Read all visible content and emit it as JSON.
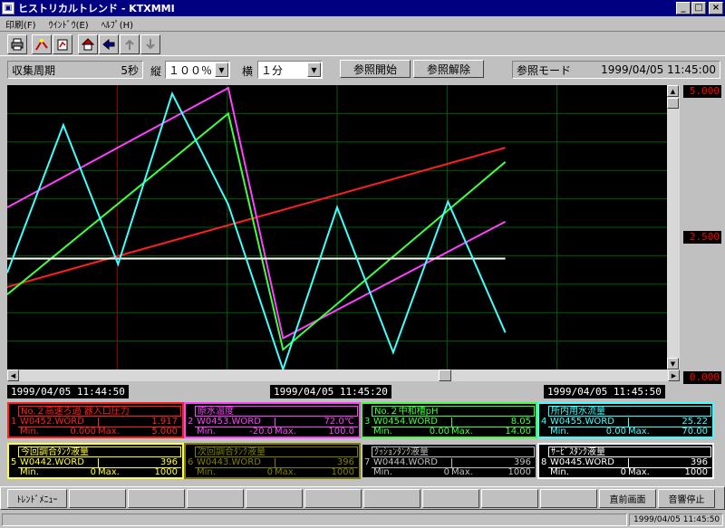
{
  "window": {
    "title": "ヒストリカルトレンド - KTXMMI",
    "minimize": "_",
    "maximize": "□",
    "close": "×"
  },
  "menu": [
    "印刷(F)",
    "ｳｲﾝﾄﾞｳ(E)",
    "ﾍﾙﾌﾟ(H)"
  ],
  "toolbar_icons": [
    "print-icon",
    "trend-edit-icon",
    "trend-settings-icon",
    "home-icon",
    "back-icon",
    "prev-page-icon",
    "next-page-icon"
  ],
  "controls": {
    "collect_label": "収集周期",
    "collect_value": "5秒",
    "vert_label": "縦",
    "vert_value": "１００％",
    "horiz_label": "横",
    "horiz_value": "１分",
    "ref_start": "参照開始",
    "ref_cancel": "参照解除",
    "mode_label": "参照モード",
    "mode_time": "1999/04/05 11:45:00"
  },
  "chart_data": {
    "type": "line",
    "ylim": [
      0,
      5
    ],
    "ytick_labels": [
      "5.000",
      "2.500",
      "0.000"
    ],
    "time_labels": [
      "1999/04/05 11:44:50",
      "1999/04/05 11:45:20",
      "1999/04/05 11:45:50"
    ],
    "series": [
      {
        "color": "#ff2020",
        "x": [
          0,
          0.755
        ],
        "y": [
          1.45,
          3.9
        ]
      },
      {
        "color": "#ff40ff",
        "x": [
          0,
          0.335,
          0.418,
          0.755
        ],
        "y": [
          2.85,
          4.95,
          0.55,
          2.6
        ]
      },
      {
        "color": "#40ff40",
        "x": [
          0,
          0.335,
          0.418,
          0.755
        ],
        "y": [
          1.32,
          4.5,
          0.35,
          3.65
        ]
      },
      {
        "color": "#ffffff",
        "x": [
          0,
          0.755
        ],
        "y": [
          1.95,
          1.95
        ]
      },
      {
        "color": "#40ffff",
        "x": [
          0,
          0.085,
          0.168,
          0.25,
          0.335,
          0.418,
          0.5,
          0.585,
          0.668,
          0.755
        ],
        "y": [
          1.7,
          4.3,
          1.85,
          4.85,
          2.9,
          0,
          2.85,
          0.3,
          2.95,
          0.65
        ]
      }
    ]
  },
  "panels": [
    {
      "num": "1",
      "name": "No.２高速ろ過 器入口圧力",
      "tag": "W0452.WORD",
      "value": "1.917",
      "min_label": "Min.",
      "min": "0.000",
      "max_label": "Max.",
      "max": "5.000",
      "color": "#ff2020"
    },
    {
      "num": "2",
      "name": "原水温度",
      "tag": "W0453.WORD",
      "value": "72.0℃",
      "min_label": "Min.",
      "min": "-20.0",
      "max_label": "Max.",
      "max": "100.0",
      "color": "#ff40ff"
    },
    {
      "num": "3",
      "name": "No.２中和槽pH",
      "tag": "W0454.WORD",
      "value": "8.05",
      "min_label": "Min.",
      "min": "0.00",
      "max_label": "Max.",
      "max": "14.00",
      "color": "#40ff40"
    },
    {
      "num": "4",
      "name": "所内用水流量",
      "tag": "W0455.WORD",
      "value": "25.22",
      "min_label": "Min.",
      "min": "0.00",
      "max_label": "Max.",
      "max": "70.00",
      "color": "#40ffff"
    },
    {
      "num": "5",
      "name": "今回調合ﾀﾝｸ液量",
      "tag": "W0442.WORD",
      "value": "396",
      "min_label": "Min.",
      "min": "0",
      "max_label": "Max.",
      "max": "1000",
      "color": "#ffff40"
    },
    {
      "num": "6",
      "name": "次回調合ﾀﾝｸ液量",
      "tag": "W0443.WORD",
      "value": "396",
      "min_label": "Min.",
      "min": "0",
      "max_label": "Max.",
      "max": "1000",
      "color": "#808000"
    },
    {
      "num": "7",
      "name": "ｸｯｼｮﾝﾀﾝｸ液量",
      "tag": "W0444.WORD",
      "value": "396",
      "min_label": "Min.",
      "min": "0",
      "max_label": "Max.",
      "max": "1000",
      "color": "#c0c0c0"
    },
    {
      "num": "8",
      "name": "ｻｰﾋﾞｽﾀﾝｸ液量",
      "tag": "W0445.WORD",
      "value": "396",
      "min_label": "Min.",
      "min": "0",
      "max_label": "Max.",
      "max": "1000",
      "color": "#ffffff"
    }
  ],
  "fkeys": [
    "ﾄﾚﾝﾄﾞﾒﾆｭｰ",
    "",
    "",
    "",
    "",
    "",
    "",
    "",
    "",
    "",
    "直前画面",
    "音響停止"
  ],
  "status": {
    "time": "1999/04/05 11:45:50"
  }
}
